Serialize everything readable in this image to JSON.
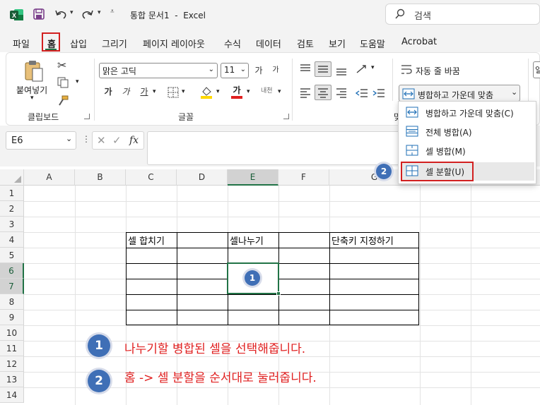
{
  "title_bar": {
    "qat_icons": [
      "excel-logo-icon",
      "save-icon",
      "undo-icon",
      "redo-icon",
      "customize-qat-icon"
    ],
    "doc_title": "통합 문서1  -  Excel",
    "search_placeholder": "검색"
  },
  "menu": {
    "tabs": [
      "파일",
      "홈",
      "삽입",
      "그리기",
      "페이지 레이아웃",
      "수식",
      "데이터",
      "검토",
      "보기",
      "도움말",
      "Acrobat"
    ],
    "active": "홈"
  },
  "ribbon": {
    "clipboard": {
      "paste_label": "붙여넣기",
      "group_label": "클립보드"
    },
    "font": {
      "font_name": "맑은 고딕",
      "font_size": "11",
      "grow": "가",
      "shrink": "가",
      "bold": "가",
      "italic": "가",
      "underline": "가",
      "font_color_glyph": "가",
      "phonetic": "내천",
      "group_label": "글꼴"
    },
    "alignment": {
      "wrap_text": "자동 줄 바꿈",
      "merge_center": "병합하고 가운데 맞춤",
      "group_label_partial": "맞"
    }
  },
  "merge_menu": {
    "items": [
      {
        "label": "병합하고 가운데 맞춤(C)",
        "icon": "merge-center-icon"
      },
      {
        "label": "전체 병합(A)",
        "icon": "merge-across-icon"
      },
      {
        "label": "셀 병합(M)",
        "icon": "merge-cells-icon"
      },
      {
        "label": "셀 분할(U)",
        "icon": "unmerge-cells-icon"
      }
    ]
  },
  "formula_bar": {
    "name_box": "E6",
    "fx": "fx",
    "value": ""
  },
  "sheet": {
    "columns": [
      "A",
      "B",
      "C",
      "D",
      "E",
      "F",
      "G"
    ],
    "rows": [
      "1",
      "2",
      "3",
      "4",
      "5",
      "6",
      "7",
      "8",
      "9",
      "10",
      "11",
      "12",
      "13",
      "14"
    ],
    "cells": {
      "C4": "셀 합치기",
      "E4": "셀나누기",
      "G4": "단축키 지정하기"
    }
  },
  "annotations": {
    "steps": [
      {
        "num": "1",
        "text": "나누기할 병합된 셀을 선택해줍니다."
      },
      {
        "num": "2",
        "text": "홈 -> 셀 분할을 순서대로 눌러줍니다."
      }
    ],
    "badge_colors": {
      "fill": "#3f6fb6",
      "ring": "#d7dcea"
    },
    "highlight_color": "#d22020"
  },
  "colors": {
    "accent": "#217346",
    "selection": "#217346"
  }
}
